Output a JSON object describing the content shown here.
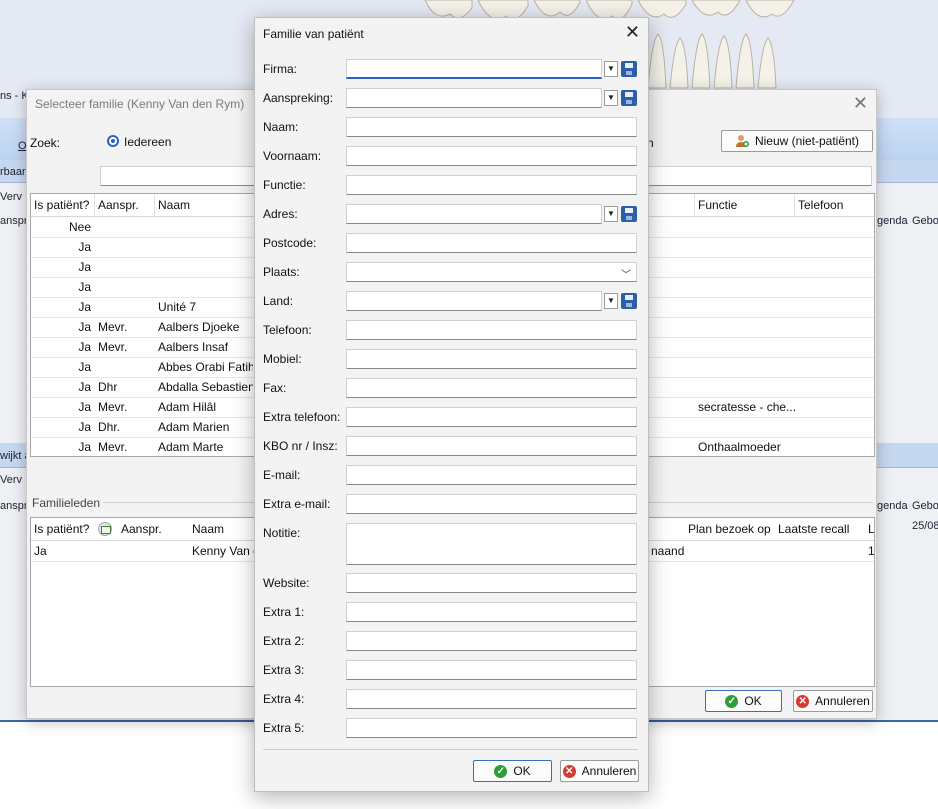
{
  "background": {
    "frag_1": "ns - K",
    "frag_2": "O",
    "frag_3": "rbaar",
    "frag_4": "Verv",
    "frag_5": "anspr.",
    "frag_6": "wijkt a",
    "frag_7": "Verv",
    "frag_8": "anspr.",
    "right_header_1": "genda",
    "right_header_2": "Gebo",
    "right_header_3": "genda",
    "right_header_4": "Gebo",
    "right_value": "25/08"
  },
  "select_dialog": {
    "title": "Selecteer familie (Kenny Van den Rym)",
    "search_label": "Zoek:",
    "radio_label": "Iedereen",
    "partial_label": "n",
    "new_button": "Nieuw (niet-patiënt)",
    "columns": [
      "Is patiënt?",
      "Aanspr.",
      "Naam",
      "Functie",
      "Telefoon"
    ],
    "rows": [
      {
        "is_patient": "Nee",
        "aanspr": "",
        "naam": "",
        "functie": ""
      },
      {
        "is_patient": "Ja",
        "aanspr": "",
        "naam": "",
        "functie": ""
      },
      {
        "is_patient": "Ja",
        "aanspr": "",
        "naam": "",
        "functie": ""
      },
      {
        "is_patient": "Ja",
        "aanspr": "",
        "naam": "",
        "functie": ""
      },
      {
        "is_patient": "Ja",
        "aanspr": "",
        "naam": "Unité 7",
        "functie": ""
      },
      {
        "is_patient": "Ja",
        "aanspr": "Mevr.",
        "naam": "Aalbers Djoeke",
        "functie": ""
      },
      {
        "is_patient": "Ja",
        "aanspr": "Mevr.",
        "naam": "Aalbers Insaf",
        "functie": ""
      },
      {
        "is_patient": "Ja",
        "aanspr": "",
        "naam": "Abbes Orabi Fatiha",
        "functie": ""
      },
      {
        "is_patient": "Ja",
        "aanspr": "Dhr",
        "naam": "Abdalla Sebastien",
        "functie": ""
      },
      {
        "is_patient": "Ja",
        "aanspr": "Mevr.",
        "naam": "Adam Hilâl",
        "functie": "secratesse - che..."
      },
      {
        "is_patient": "Ja",
        "aanspr": "Dhr.",
        "naam": "Adam Marien",
        "functie": ""
      },
      {
        "is_patient": "Ja",
        "aanspr": "Mevr.",
        "naam": "Adam Marte",
        "functie": "Onthaalmoeder"
      }
    ],
    "familieleden_label": "Familieleden",
    "fam_columns": [
      "Is patiënt?",
      "Aanspr.",
      "Naam",
      "Plan bezoek op",
      "Laatste recall",
      "L"
    ],
    "fam_row": {
      "is_patient": "Ja",
      "naam": "Kenny Van d",
      "partial": "naand",
      "last": "1"
    },
    "ok_label": "OK",
    "cancel_label": "Annuleren"
  },
  "family_dialog": {
    "title": "Familie van patiënt",
    "fields": [
      {
        "label": "Firma:",
        "value": ""
      },
      {
        "label": "Aanspreking:",
        "value": ""
      },
      {
        "label": "Naam:",
        "value": ""
      },
      {
        "label": "Voornaam:",
        "value": ""
      },
      {
        "label": "Functie:",
        "value": ""
      },
      {
        "label": "Adres:",
        "value": ""
      },
      {
        "label": "Postcode:",
        "value": ""
      },
      {
        "label": "Plaats:",
        "value": ""
      },
      {
        "label": "Land:",
        "value": ""
      },
      {
        "label": "Telefoon:",
        "value": ""
      },
      {
        "label": "Mobiel:",
        "value": ""
      },
      {
        "label": "Fax:",
        "value": ""
      },
      {
        "label": "Extra telefoon:",
        "value": ""
      },
      {
        "label": "KBO nr / Insz:",
        "value": ""
      },
      {
        "label": "E-mail:",
        "value": ""
      },
      {
        "label": "Extra e-mail:",
        "value": ""
      },
      {
        "label": "Notitie:",
        "value": ""
      },
      {
        "label": "Website:",
        "value": ""
      },
      {
        "label": "Extra 1:",
        "value": ""
      },
      {
        "label": "Extra 2:",
        "value": ""
      },
      {
        "label": "Extra 3:",
        "value": ""
      },
      {
        "label": "Extra 4:",
        "value": ""
      },
      {
        "label": "Extra 5:",
        "value": ""
      }
    ],
    "ok_label": "OK",
    "cancel_label": "Annuleren"
  }
}
